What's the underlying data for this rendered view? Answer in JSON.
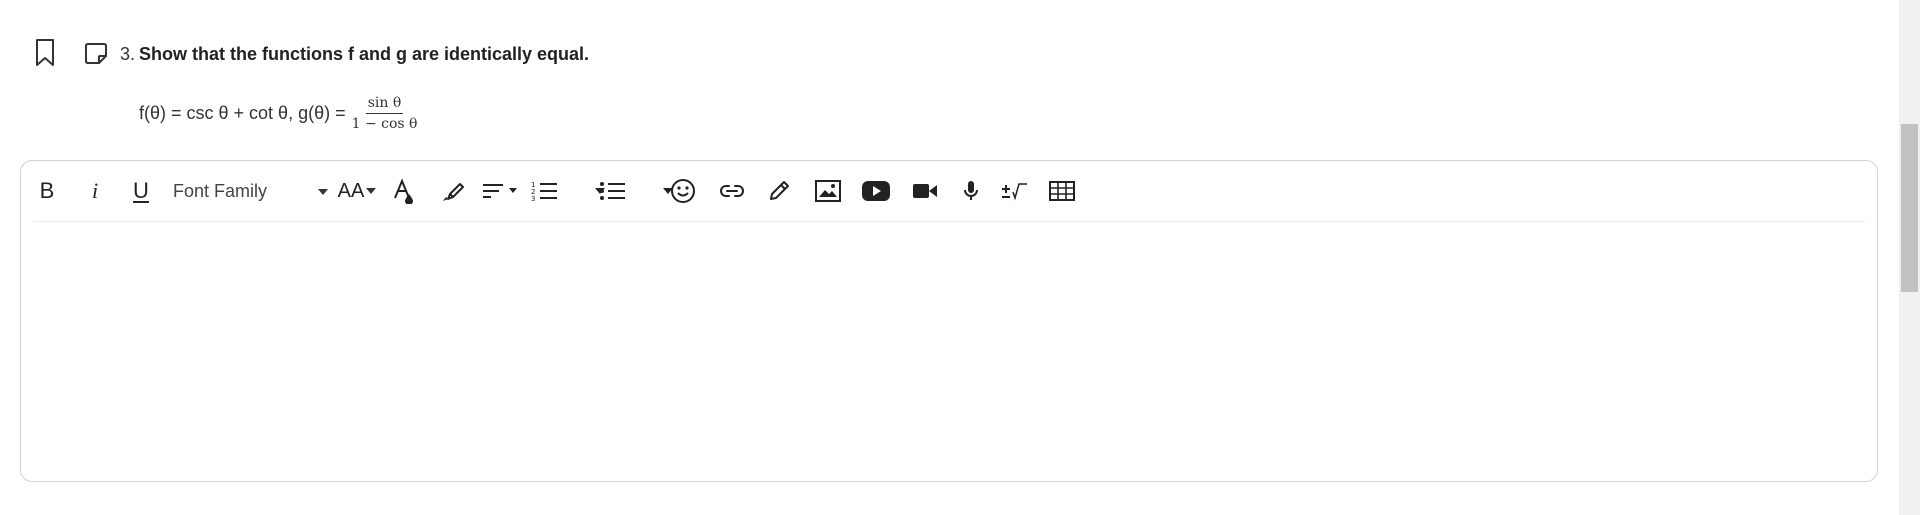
{
  "question": {
    "number": "3.",
    "prompt": "Show that the functions f and g are identically equal.",
    "formula_main": "f(θ) = csc θ + cot θ, g(θ) =",
    "fraction_numerator": "sin θ",
    "fraction_denominator": "1 − cos θ"
  },
  "toolbar": {
    "bold_label": "B",
    "italic_label": "i",
    "underline_label": "U",
    "font_family_label": "Font Family",
    "font_size_label": "AA",
    "icons": [
      "text-color-icon",
      "highlighter-icon",
      "align-icon",
      "ordered-list-icon",
      "unordered-list-icon",
      "emoji-icon",
      "link-icon",
      "pencil-icon",
      "image-icon",
      "youtube-icon",
      "video-icon",
      "microphone-icon",
      "math-equation-icon",
      "table-icon"
    ]
  },
  "colors": {
    "text": "#222222",
    "border": "#d2d2d2",
    "scrollbar_track": "#f1f1f1",
    "scrollbar_thumb": "#c1c1c1"
  }
}
